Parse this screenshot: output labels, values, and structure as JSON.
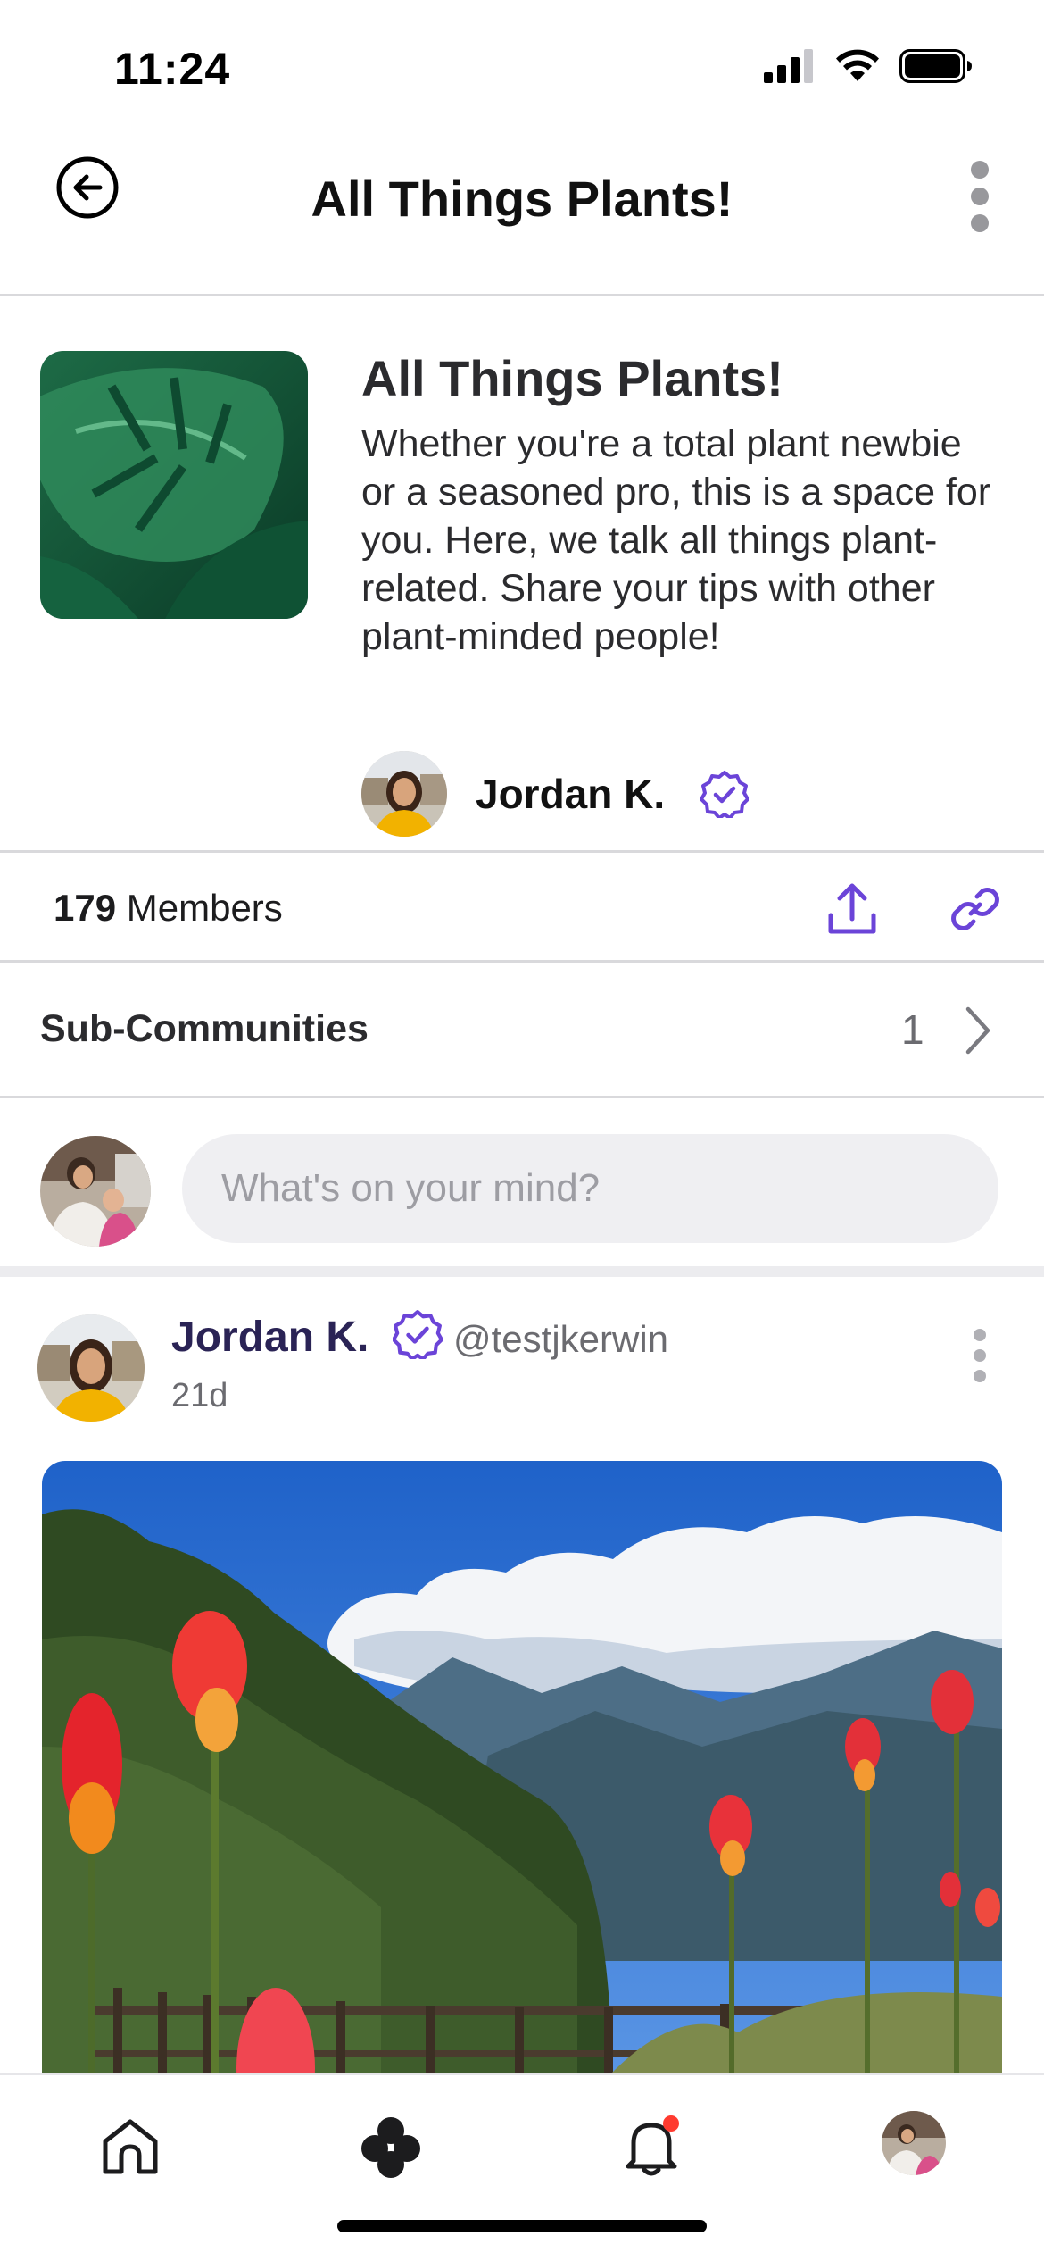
{
  "status_bar": {
    "time": "11:24",
    "icons": [
      "cellular-signal-icon",
      "wifi-icon",
      "battery-icon"
    ]
  },
  "nav": {
    "title": "All Things Plants!",
    "back_icon": "back-arrow-circle-icon",
    "more_icon": "vertical-ellipsis-icon"
  },
  "community": {
    "name": "All Things Plants!",
    "description": "Whether you're a total plant newbie or a seasoned pro, this is a space for you. Here, we talk all things plant-related. Share your tips with other plant-minded people!",
    "owner_name": "Jordan K.",
    "owner_verified": true
  },
  "members": {
    "count": "179",
    "label": "Members",
    "share_icon": "share-upload-icon",
    "link_icon": "link-icon"
  },
  "sub_communities": {
    "label": "Sub-Communities",
    "count": "1"
  },
  "composer": {
    "placeholder": "What's on your mind?"
  },
  "post": {
    "author": "Jordan K.",
    "handle": "@testjkerwin",
    "time": "21d",
    "verified": true
  },
  "tab_bar": {
    "items": [
      "home-icon",
      "communities-icon",
      "notifications-bell-icon",
      "profile-avatar"
    ],
    "notification_badge": true
  },
  "colors": {
    "accent": "#6b44d8",
    "author_text": "#2a2355",
    "divider": "#d9d9dc",
    "input_bg": "#efeff2",
    "badge": "#ff3b30"
  }
}
